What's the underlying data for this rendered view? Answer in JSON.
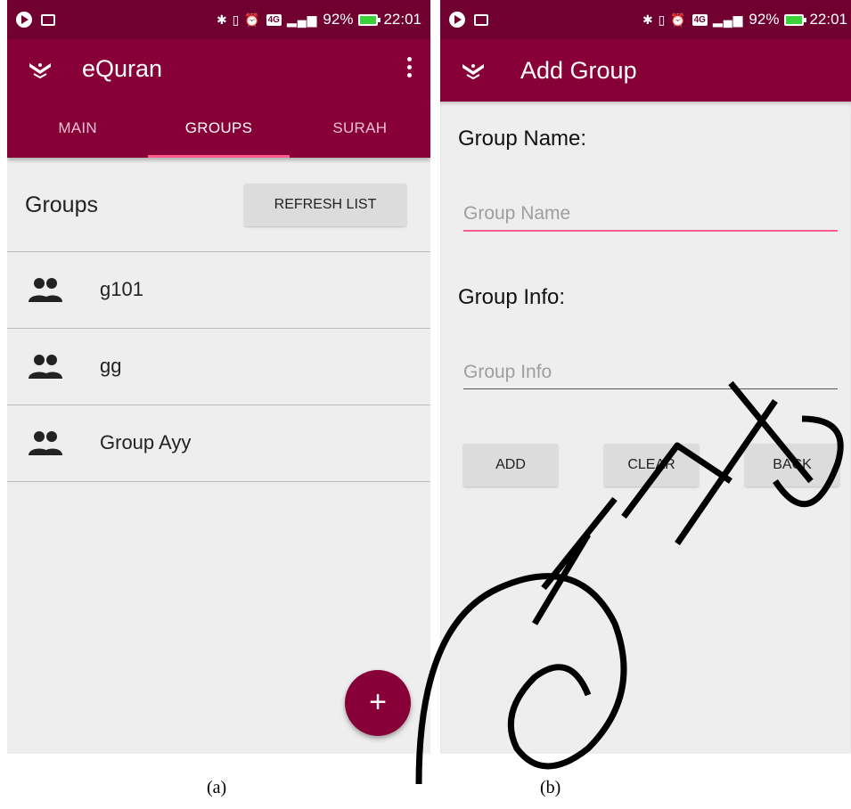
{
  "status_bar": {
    "battery": "92%",
    "time": "22:01",
    "network": "4G"
  },
  "screen_a": {
    "app_title": "eQuran",
    "tabs": [
      "MAIN",
      "GROUPS",
      "SURAH"
    ],
    "active_tab": "GROUPS",
    "groups_title": "Groups",
    "refresh_label": "REFRESH LIST",
    "groups": [
      {
        "name": "g101"
      },
      {
        "name": "gg"
      },
      {
        "name": "Group Ayy"
      }
    ],
    "fab_label": "+"
  },
  "screen_b": {
    "app_title": "Add Group",
    "group_name_label": "Group Name:",
    "group_name_placeholder": "Group Name",
    "group_info_label": "Group Info:",
    "group_info_placeholder": "Group Info",
    "add_label": "ADD",
    "clear_label": "CLEAR",
    "back_label": "BACK"
  },
  "captions": {
    "a": "(a)",
    "b": "(b)"
  },
  "colors": {
    "status_bar": "#6f0030",
    "app_bar": "#880038",
    "accent": "#ff5c8d",
    "background": "#eeeeee"
  }
}
